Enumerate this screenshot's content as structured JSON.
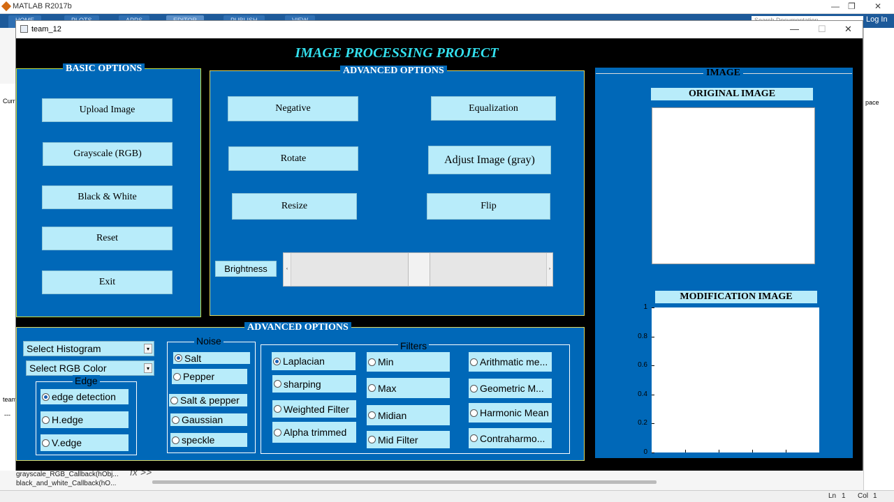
{
  "matlab": {
    "title": "MATLAB R2017b",
    "tabs": [
      "HOME",
      "PLOTS",
      "APPS",
      "EDITOR",
      "PUBLISH",
      "VIEW"
    ],
    "login": "Log In",
    "search_placeholder": "Search Documentation",
    "left_items": [
      "Curr",
      "team",
      "---"
    ],
    "workspace_label": "pace",
    "bottom_items": [
      "grayscale_RGB_Callback(hObj...",
      "black_and_white_Callback(hO..."
    ],
    "prompt": "fx >>",
    "status": {
      "ln_label": "Ln",
      "ln": "1",
      "col_label": "Col",
      "col": "1"
    }
  },
  "figure": {
    "title": "team_12",
    "controls": {
      "minimize": "—",
      "maximize": "☐",
      "close": "✕"
    },
    "heading": "IMAGE PROCESSING PROJECT",
    "basic": {
      "title": "BASIC OPTIONS",
      "buttons": [
        "Upload Image",
        "Grayscale (RGB)",
        "Black & White",
        "Reset",
        "Exit"
      ]
    },
    "advanced": {
      "title": "ADVANCED OPTIONS",
      "buttons": [
        "Negative",
        "Equalization",
        "Rotate",
        "Adjust Image (gray)",
        "Resize",
        "Flip"
      ],
      "brightness_label": "Brightness",
      "brightness_value": 0.5
    },
    "image": {
      "title": "IMAGE",
      "original_label": "ORIGINAL IMAGE",
      "modification_label": "MODIFICATION IMAGE",
      "yticks": [
        "1",
        "0.8",
        "0.6",
        "0.4",
        "0.2",
        "0"
      ]
    },
    "advanced2": {
      "title": "ADVANCED OPTIONS",
      "select_histogram": "Select Histogram",
      "select_rgb": "Select RGB Color",
      "edge": {
        "title": "Edge",
        "options": [
          "edge detection",
          "H.edge",
          "V.edge"
        ],
        "selected": 0
      },
      "noise": {
        "title": "Noise",
        "options": [
          "Salt",
          "Pepper",
          "Salt & pepper",
          "Gaussian",
          "speckle"
        ],
        "selected": 0
      },
      "filters": {
        "title": "Filters",
        "col1": [
          "Laplacian",
          "sharping",
          "Weighted Filter",
          "Alpha trimmed"
        ],
        "col2": [
          "Min",
          "Max",
          "Midian",
          "Mid Filter"
        ],
        "col3": [
          "Arithmatic me...",
          "Geometric M...",
          "Harmonic Mean",
          "Contraharmo..."
        ],
        "selected": "Laplacian"
      }
    }
  }
}
